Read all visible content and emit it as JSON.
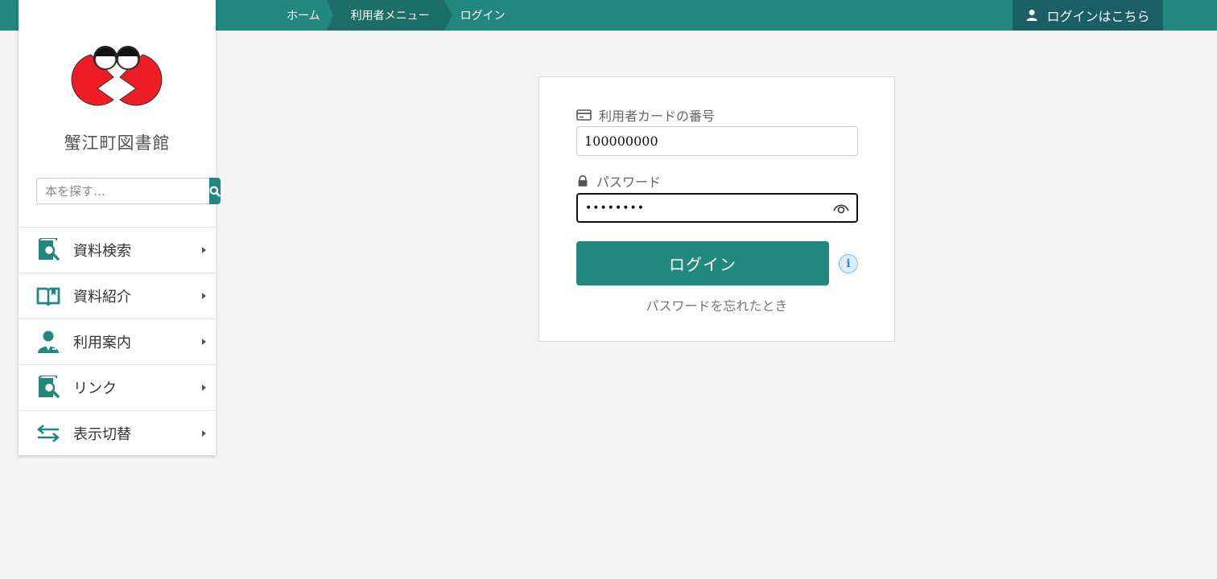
{
  "breadcrumbs": [
    "ホーム",
    "利用者メニュー",
    "ログイン"
  ],
  "header": {
    "login_label": "ログインはこちら"
  },
  "sidebar": {
    "library_name": "蟹江町図書館",
    "search": {
      "placeholder": "本を探す…"
    },
    "items": [
      {
        "label": "資料検索"
      },
      {
        "label": "資料紹介"
      },
      {
        "label": "利用案内"
      },
      {
        "label": "リンク"
      },
      {
        "label": "表示切替"
      }
    ]
  },
  "login": {
    "card_number_label": "利用者カードの番号",
    "card_number_value": "100000000",
    "password_label": "パスワード",
    "password_value": "••••••••",
    "submit_label": "ログイン",
    "info_symbol": "i",
    "forgot_label": "パスワードを忘れたとき"
  },
  "colors": {
    "accent": "#22877d",
    "accent_dark": "#1b5e63",
    "logo_red": "#ee1c25"
  }
}
